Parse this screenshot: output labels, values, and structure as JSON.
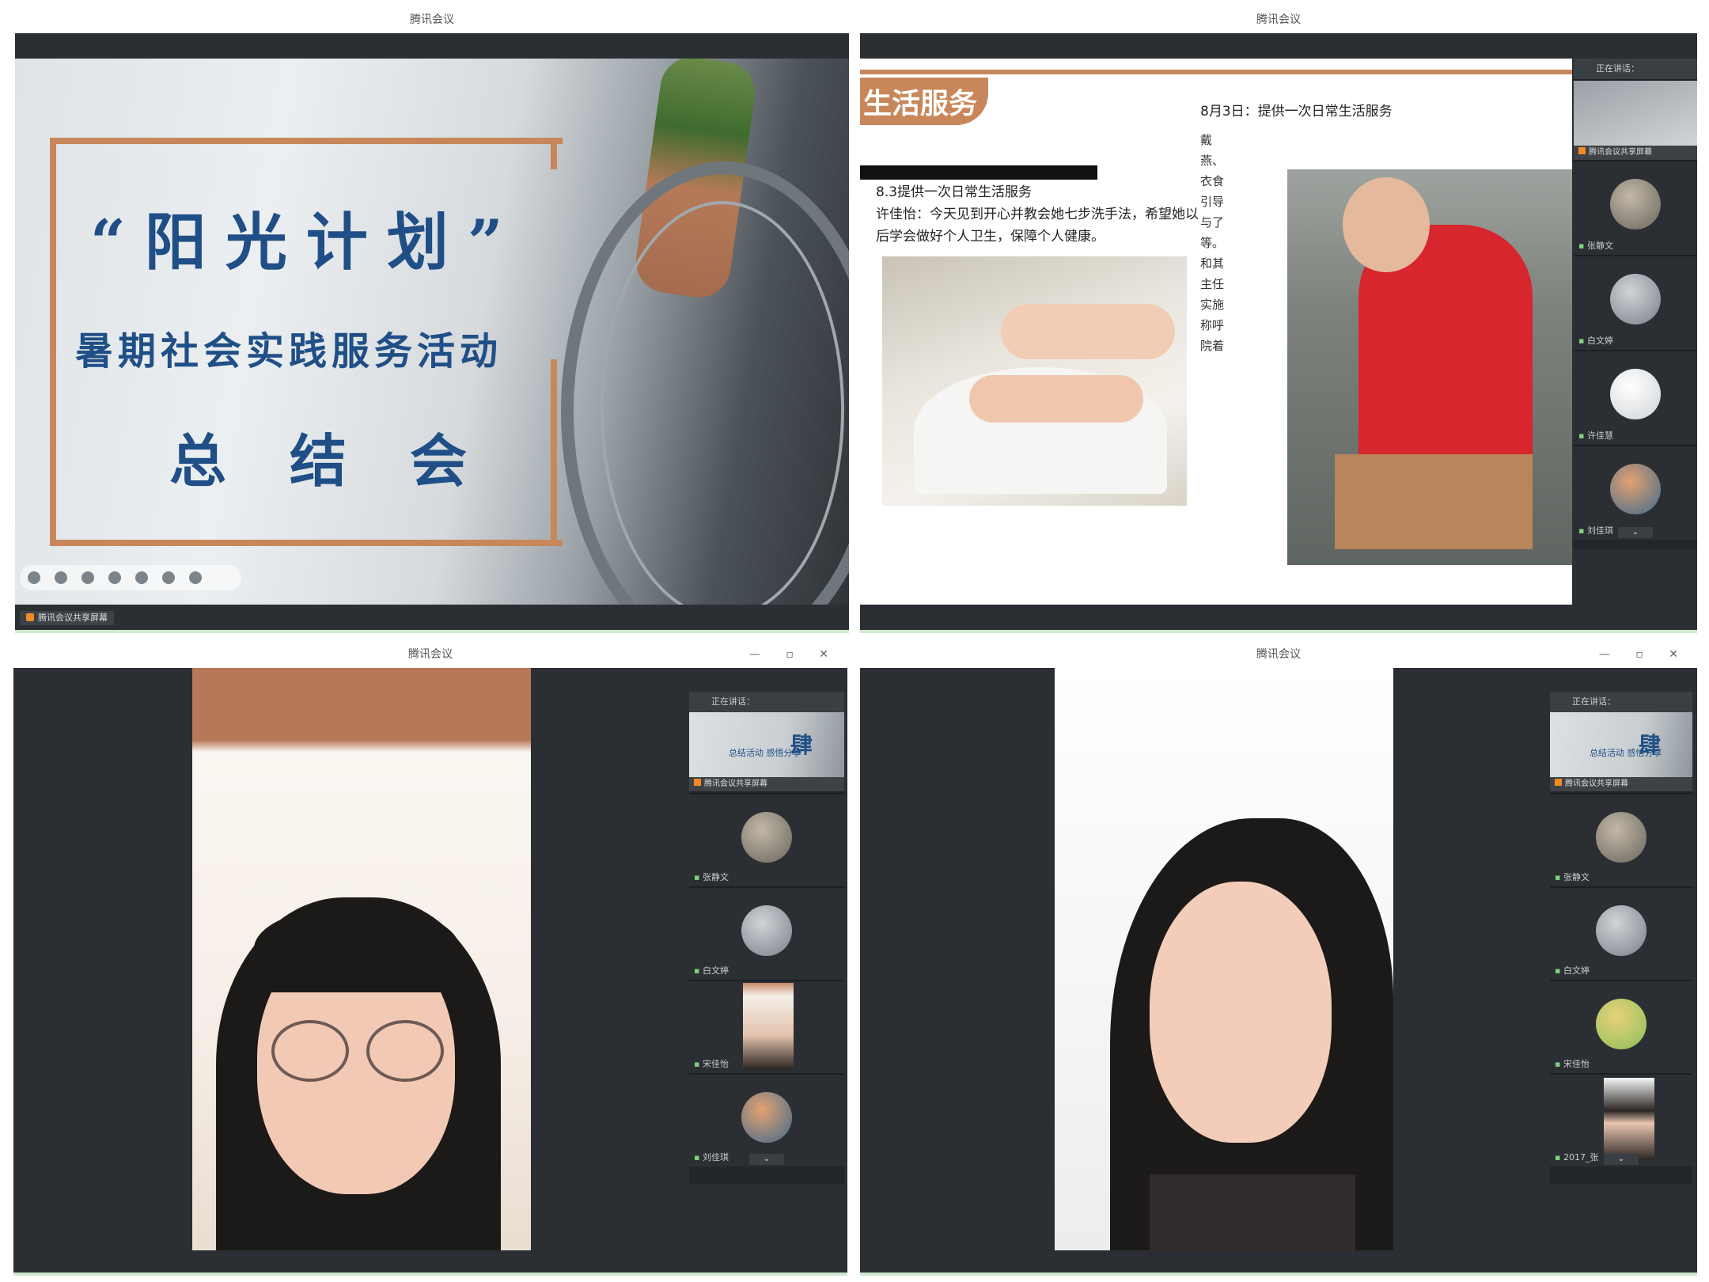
{
  "windows": {
    "w1": {
      "title": "腾讯会议",
      "speaker": "腾讯会议共享屏幕"
    },
    "w2": {
      "title": "腾讯会议"
    },
    "w3": {
      "title": "腾讯会议",
      "controls": "— ▫ ✕"
    },
    "w4": {
      "title": "腾讯会议",
      "controls": "— ▫ ✕"
    }
  },
  "slide1": {
    "line1": "“阳光计划”",
    "line2": "暑期社会实践服务活动",
    "line3": "总结会"
  },
  "slide2": {
    "section": "生活服务",
    "date_line": "8月3日：提供一次日常生活服务",
    "caption_title": "8.3提供一次日常生活服务",
    "caption_body": "许佳怡：今天见到开心并教会她七步洗手法，希望她以后学会做好个人卫生，保障个人健康。",
    "side_text": "戴燕、衣食引导与了等。和其主任实施称呼院着"
  },
  "panel": {
    "header": "正在讲话：",
    "slide_thumb_char": "肆",
    "slide_thumb_text": "总结活动 感悟分享",
    "thumb_bar": "腾讯会议共享屏幕",
    "names": [
      "张静文",
      "白文婷",
      "许佳慧",
      "刘佳琪",
      "宋佳怡",
      "2017_张"
    ]
  },
  "icons": {
    "mic": "mic-icon",
    "chevron": "chevron-down-icon"
  }
}
